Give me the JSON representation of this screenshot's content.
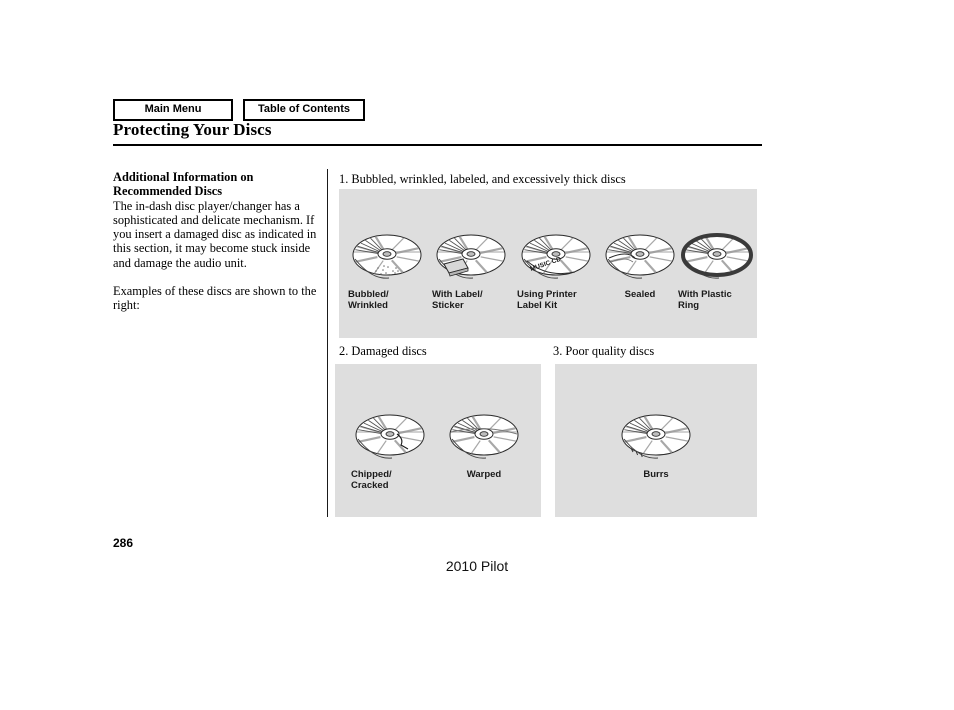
{
  "nav": {
    "main_menu_label": "Main Menu",
    "table_of_contents_label": "Table of Contents"
  },
  "header": {
    "title": "Protecting Your Discs"
  },
  "left_column": {
    "subheading": "Additional Information on Recommended Discs",
    "paragraph1": "The in-dash disc player/changer has a sophisticated and delicate mechanism. If you insert a damaged disc as indicated in this section, it may become stuck inside and damage the audio unit.",
    "paragraph2": "Examples of these discs are shown to the right:"
  },
  "figures": [
    {
      "caption": "1. Bubbled, wrinkled, labeled, and excessively thick discs",
      "discs": [
        {
          "label": "Bubbled/\nWrinkled",
          "art": "disc-bubbled"
        },
        {
          "label": "With Label/\nSticker",
          "art": "disc-sticker"
        },
        {
          "label": "Using Printer\nLabel Kit",
          "art": "disc-printer-label",
          "disc_text": "MUSIC CD"
        },
        {
          "label": "Sealed",
          "art": "disc-sealed"
        },
        {
          "label": "With Plastic\nRing",
          "art": "disc-plastic-ring"
        }
      ]
    },
    {
      "caption": "2. Damaged discs",
      "discs": [
        {
          "label": "Chipped/\nCracked",
          "art": "disc-chipped"
        },
        {
          "label": "Warped",
          "art": "disc-warped"
        }
      ]
    },
    {
      "caption": "3. Poor quality discs",
      "discs": [
        {
          "label": "Burrs",
          "art": "disc-burrs"
        }
      ]
    }
  ],
  "footer": {
    "page_number": "286",
    "model": "2010 Pilot"
  },
  "colors": {
    "panel_background": "#dedede",
    "text": "#000000",
    "disc_shading": "#9a9a9a"
  }
}
